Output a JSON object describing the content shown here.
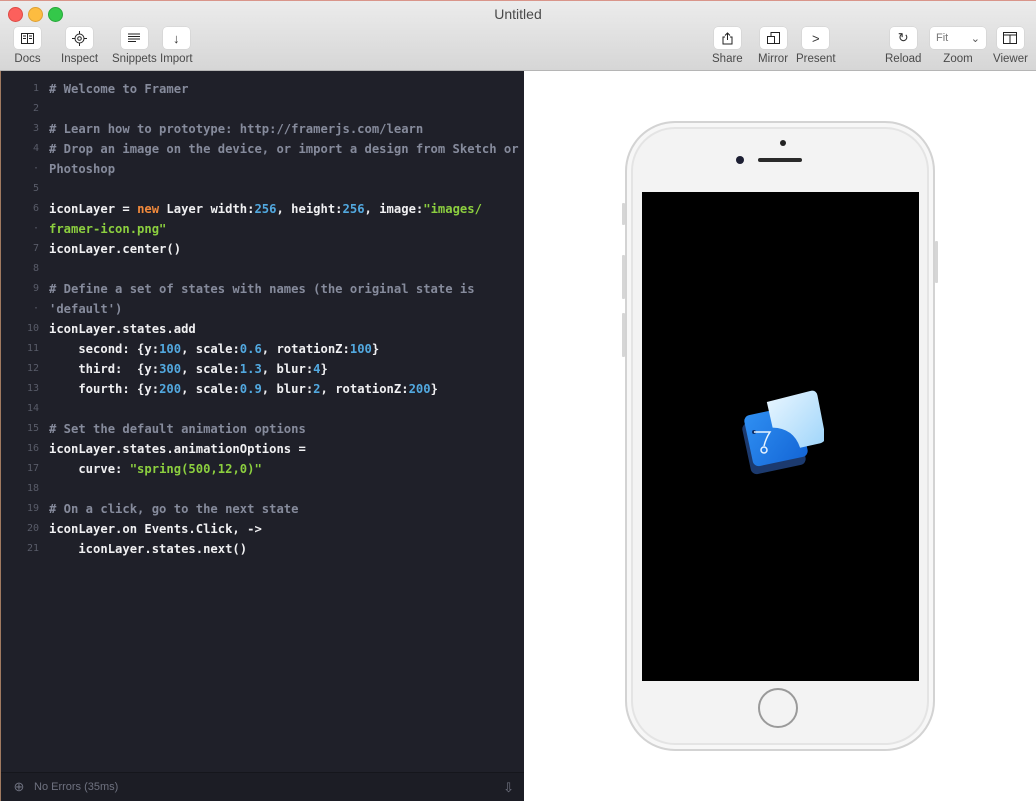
{
  "window": {
    "title": "Untitled"
  },
  "toolbar": {
    "left": [
      {
        "label": "Docs",
        "icon": "book-icon"
      },
      {
        "label": "Inspect",
        "icon": "target-icon"
      },
      {
        "label": "Snippets",
        "icon": "lines-icon"
      },
      {
        "label": "Import",
        "icon": "arrow-down-icon"
      }
    ],
    "right": [
      {
        "label": "Share",
        "icon": "share-icon"
      },
      {
        "label": "Mirror",
        "icon": "mirror-icon"
      },
      {
        "label": "Present",
        "icon": "chevron-right-icon"
      },
      {
        "label": "Reload",
        "icon": "reload-icon"
      },
      {
        "label": "Zoom",
        "value": "Fit"
      },
      {
        "label": "Viewer",
        "icon": "viewer-layout-icon"
      }
    ]
  },
  "editor": {
    "lines": [
      {
        "num": "1",
        "tokens": [
          {
            "t": "# Welcome to Framer",
            "c": "c"
          }
        ]
      },
      {
        "num": "2",
        "tokens": []
      },
      {
        "num": "3",
        "tokens": [
          {
            "t": "# Learn how to prototype: http://framerjs.com/learn",
            "c": "c"
          }
        ]
      },
      {
        "num": "4",
        "tokens": [
          {
            "t": "# Drop an image on the device, or import a design from Sketch or",
            "c": "c"
          }
        ]
      },
      {
        "num": "·",
        "tokens": [
          {
            "t": "Photoshop",
            "c": "c"
          }
        ]
      },
      {
        "num": "5",
        "tokens": []
      },
      {
        "num": "6",
        "tokens": [
          {
            "t": "iconLayer = ",
            "c": "tx"
          },
          {
            "t": "new",
            "c": "k"
          },
          {
            "t": " Layer width:",
            "c": "tx"
          },
          {
            "t": "256",
            "c": "n"
          },
          {
            "t": ", height:",
            "c": "tx"
          },
          {
            "t": "256",
            "c": "n"
          },
          {
            "t": ", image:",
            "c": "tx"
          },
          {
            "t": "\"images/",
            "c": "s"
          }
        ]
      },
      {
        "num": "·",
        "tokens": [
          {
            "t": "framer-icon.png\"",
            "c": "s"
          }
        ]
      },
      {
        "num": "7",
        "tokens": [
          {
            "t": "iconLayer.center()",
            "c": "tx"
          }
        ]
      },
      {
        "num": "8",
        "tokens": []
      },
      {
        "num": "9",
        "tokens": [
          {
            "t": "# Define a set of states with names (the original state is",
            "c": "c"
          }
        ]
      },
      {
        "num": "·",
        "tokens": [
          {
            "t": "'default')",
            "c": "c"
          }
        ]
      },
      {
        "num": "10",
        "tokens": [
          {
            "t": "iconLayer.states.add",
            "c": "tx"
          }
        ]
      },
      {
        "num": "11",
        "tokens": [
          {
            "t": "    second: {y:",
            "c": "tx"
          },
          {
            "t": "100",
            "c": "n"
          },
          {
            "t": ", scale:",
            "c": "tx"
          },
          {
            "t": "0.6",
            "c": "n"
          },
          {
            "t": ", rotationZ:",
            "c": "tx"
          },
          {
            "t": "100",
            "c": "n"
          },
          {
            "t": "}",
            "c": "tx"
          }
        ]
      },
      {
        "num": "12",
        "tokens": [
          {
            "t": "    third:  {y:",
            "c": "tx"
          },
          {
            "t": "300",
            "c": "n"
          },
          {
            "t": ", scale:",
            "c": "tx"
          },
          {
            "t": "1.3",
            "c": "n"
          },
          {
            "t": ", blur:",
            "c": "tx"
          },
          {
            "t": "4",
            "c": "n"
          },
          {
            "t": "}",
            "c": "tx"
          }
        ]
      },
      {
        "num": "13",
        "tokens": [
          {
            "t": "    fourth: {y:",
            "c": "tx"
          },
          {
            "t": "200",
            "c": "n"
          },
          {
            "t": ", scale:",
            "c": "tx"
          },
          {
            "t": "0.9",
            "c": "n"
          },
          {
            "t": ", blur:",
            "c": "tx"
          },
          {
            "t": "2",
            "c": "n"
          },
          {
            "t": ", rotationZ:",
            "c": "tx"
          },
          {
            "t": "200",
            "c": "n"
          },
          {
            "t": "}",
            "c": "tx"
          }
        ]
      },
      {
        "num": "14",
        "tokens": []
      },
      {
        "num": "15",
        "tokens": [
          {
            "t": "# Set the default animation options",
            "c": "c"
          }
        ]
      },
      {
        "num": "16",
        "tokens": [
          {
            "t": "iconLayer.states.animationOptions =",
            "c": "tx"
          }
        ]
      },
      {
        "num": "17",
        "tokens": [
          {
            "t": "    curve: ",
            "c": "tx"
          },
          {
            "t": "\"spring(500,12,0)\"",
            "c": "s"
          }
        ]
      },
      {
        "num": "18",
        "tokens": []
      },
      {
        "num": "19",
        "tokens": [
          {
            "t": "# On a click, go to the next state",
            "c": "c"
          }
        ]
      },
      {
        "num": "20",
        "tokens": [
          {
            "t": "iconLayer.on Events.Click, ->",
            "c": "tx"
          }
        ]
      },
      {
        "num": "21",
        "tokens": [
          {
            "t": "    iconLayer.states.next()",
            "c": "tx"
          }
        ]
      }
    ]
  },
  "status": {
    "text": "No Errors (35ms)"
  },
  "device": {
    "model": "iPhone (silver)",
    "screen_content": "framer-icon"
  },
  "colors": {
    "editor_bg": "#1f2029",
    "comment": "#868b9c",
    "keyword": "#f28a3c",
    "number": "#52a9e0",
    "string": "#8ccf3f"
  }
}
